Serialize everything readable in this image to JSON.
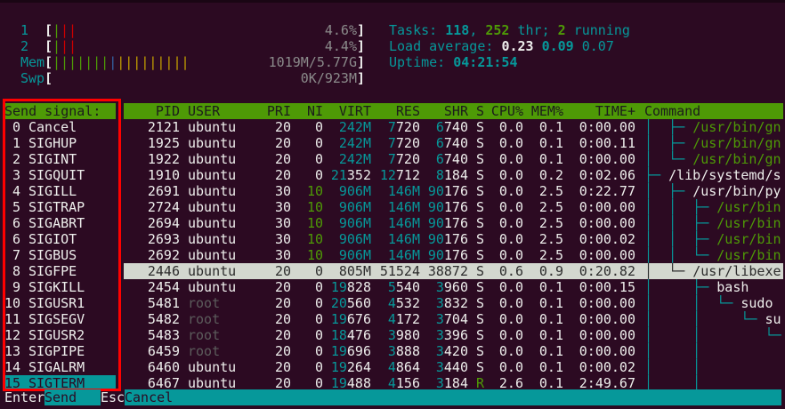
{
  "meters": {
    "cpu1": {
      "label": "1",
      "bars": [
        {
          "c": "green",
          "t": "|"
        },
        {
          "c": "red",
          "t": "||"
        }
      ],
      "value": "4.6%"
    },
    "cpu2": {
      "label": "2",
      "bars": [
        {
          "c": "green",
          "t": "|"
        },
        {
          "c": "red",
          "t": "||"
        }
      ],
      "value": "4.4%"
    },
    "mem": {
      "label": "Mem",
      "bars": [
        {
          "c": "green",
          "t": "|||||||"
        },
        {
          "c": "blue",
          "t": "|"
        },
        {
          "c": "yellow",
          "t": "|||||||||"
        }
      ],
      "value": "1019M/5.77G"
    },
    "swp": {
      "label": "Swp",
      "bars": [],
      "value": "0K/923M"
    }
  },
  "stats": {
    "tasks_label": "Tasks: ",
    "tasks": "118",
    "sep1": ", ",
    "threads": "252",
    "thr_label": " thr; ",
    "running": "2",
    "running_label": " running",
    "load_label": "Load average: ",
    "load1": "0.23",
    "load5": "0.09",
    "load15": "0.07",
    "uptime_label": "Uptime: ",
    "uptime": "04:21:54"
  },
  "signal_panel": {
    "title": "Send signal:",
    "signals": [
      {
        "num": "0",
        "name": "Cancel"
      },
      {
        "num": "1",
        "name": "SIGHUP"
      },
      {
        "num": "2",
        "name": "SIGINT"
      },
      {
        "num": "3",
        "name": "SIGQUIT"
      },
      {
        "num": "4",
        "name": "SIGILL"
      },
      {
        "num": "5",
        "name": "SIGTRAP"
      },
      {
        "num": "6",
        "name": "SIGABRT"
      },
      {
        "num": "6",
        "name": "SIGIOT"
      },
      {
        "num": "7",
        "name": "SIGBUS"
      },
      {
        "num": "8",
        "name": "SIGFPE"
      },
      {
        "num": "9",
        "name": "SIGKILL"
      },
      {
        "num": "10",
        "name": "SIGUSR1"
      },
      {
        "num": "11",
        "name": "SIGSEGV"
      },
      {
        "num": "12",
        "name": "SIGUSR2"
      },
      {
        "num": "13",
        "name": "SIGPIPE"
      },
      {
        "num": "14",
        "name": "SIGALRM"
      },
      {
        "num": "15",
        "name": "SIGTERM"
      }
    ],
    "selected_index": 16
  },
  "table": {
    "headers": {
      "pid": "PID",
      "user": "USER",
      "pri": "PRI",
      "ni": "NI",
      "virt": "VIRT",
      "res": "RES",
      "shr": "SHR",
      "s": "S",
      "cpu": "CPU%",
      "mem": "MEM%",
      "time": "TIME+",
      "cmd": "Command"
    },
    "selected_index": 9,
    "rows": [
      {
        "pid": "2121",
        "user": "ubuntu",
        "pri": "20",
        "ni": "0",
        "virt": "242M",
        "res": "7720",
        "shr": "6740",
        "s": "S",
        "cpu": "0.0",
        "mem": "0.1",
        "time": "0:00.00",
        "tree": "│  ├─ ",
        "cmd": "/usr/bin/gn",
        "cmd_color": "green"
      },
      {
        "pid": "1925",
        "user": "ubuntu",
        "pri": "20",
        "ni": "0",
        "virt": "242M",
        "res": "7720",
        "shr": "6740",
        "s": "S",
        "cpu": "0.0",
        "mem": "0.1",
        "time": "0:00.11",
        "tree": "│  ├─ ",
        "cmd": "/usr/bin/gn",
        "cmd_color": "green"
      },
      {
        "pid": "1922",
        "user": "ubuntu",
        "pri": "20",
        "ni": "0",
        "virt": "242M",
        "res": "7720",
        "shr": "6740",
        "s": "S",
        "cpu": "0.0",
        "mem": "0.1",
        "time": "0:00.00",
        "tree": "│  └─ ",
        "cmd": "/usr/bin/gn",
        "cmd_color": "green"
      },
      {
        "pid": "1910",
        "user": "ubuntu",
        "pri": "20",
        "ni": "0",
        "virt": "21352",
        "res": "12712",
        "shr": "8184",
        "s": "S",
        "cpu": "0.0",
        "mem": "0.2",
        "time": "0:02.06",
        "tree": "├─ ",
        "cmd": "/lib/systemd/s",
        "cmd_color": "white"
      },
      {
        "pid": "2691",
        "user": "ubuntu",
        "pri": "30",
        "ni": "10",
        "virt": "906M",
        "res": "146M",
        "shr": "90176",
        "s": "S",
        "cpu": "0.0",
        "mem": "2.5",
        "time": "0:22.77",
        "tree": "│  ├─ ",
        "cmd": "/usr/bin/py",
        "cmd_color": "white"
      },
      {
        "pid": "2724",
        "user": "ubuntu",
        "pri": "30",
        "ni": "10",
        "virt": "906M",
        "res": "146M",
        "shr": "90176",
        "s": "S",
        "cpu": "0.0",
        "mem": "2.5",
        "time": "0:00.00",
        "tree": "│  │  ├─ ",
        "cmd": "/usr/bin",
        "cmd_color": "green"
      },
      {
        "pid": "2694",
        "user": "ubuntu",
        "pri": "30",
        "ni": "10",
        "virt": "906M",
        "res": "146M",
        "shr": "90176",
        "s": "S",
        "cpu": "0.0",
        "mem": "2.5",
        "time": "0:00.00",
        "tree": "│  │  ├─ ",
        "cmd": "/usr/bin",
        "cmd_color": "green"
      },
      {
        "pid": "2693",
        "user": "ubuntu",
        "pri": "30",
        "ni": "10",
        "virt": "906M",
        "res": "146M",
        "shr": "90176",
        "s": "S",
        "cpu": "0.0",
        "mem": "2.5",
        "time": "0:00.02",
        "tree": "│  │  ├─ ",
        "cmd": "/usr/bin",
        "cmd_color": "green"
      },
      {
        "pid": "2692",
        "user": "ubuntu",
        "pri": "30",
        "ni": "10",
        "virt": "906M",
        "res": "146M",
        "shr": "90176",
        "s": "S",
        "cpu": "0.0",
        "mem": "2.5",
        "time": "0:00.00",
        "tree": "│  │  └─ ",
        "cmd": "/usr/bin",
        "cmd_color": "green"
      },
      {
        "pid": "2446",
        "user": "ubuntu",
        "pri": "20",
        "ni": "0",
        "virt": "805M",
        "res": "51524",
        "shr": "38872",
        "s": "S",
        "cpu": "0.6",
        "mem": "0.9",
        "time": "0:20.82",
        "tree": "│  └─ ",
        "cmd": "/usr/libexe",
        "cmd_color": "white"
      },
      {
        "pid": "2454",
        "user": "ubuntu",
        "pri": "20",
        "ni": "0",
        "virt": "19828",
        "res": "5540",
        "shr": "3960",
        "s": "S",
        "cpu": "0.0",
        "mem": "0.1",
        "time": "0:00.15",
        "tree": "│     ├─ ",
        "cmd": "bash",
        "cmd_color": "white"
      },
      {
        "pid": "5481",
        "user": "root",
        "pri": "20",
        "ni": "0",
        "virt": "20560",
        "res": "4532",
        "shr": "3832",
        "s": "S",
        "cpu": "0.0",
        "mem": "0.1",
        "time": "0:00.00",
        "tree": "│     │  └─ ",
        "cmd": "sudo",
        "cmd_color": "white"
      },
      {
        "pid": "5482",
        "user": "root",
        "pri": "20",
        "ni": "0",
        "virt": "19676",
        "res": "4172",
        "shr": "3704",
        "s": "S",
        "cpu": "0.0",
        "mem": "0.1",
        "time": "0:00.00",
        "tree": "│     │     └─ ",
        "cmd": "su",
        "cmd_color": "white"
      },
      {
        "pid": "5483",
        "user": "root",
        "pri": "20",
        "ni": "0",
        "virt": "18476",
        "res": "3980",
        "shr": "3396",
        "s": "S",
        "cpu": "0.0",
        "mem": "0.1",
        "time": "0:00.00",
        "tree": "│     │        └─",
        "cmd": "",
        "cmd_color": "white"
      },
      {
        "pid": "6459",
        "user": "root",
        "pri": "20",
        "ni": "0",
        "virt": "19696",
        "res": "3888",
        "shr": "3420",
        "s": "S",
        "cpu": "0.0",
        "mem": "0.1",
        "time": "0:00.00",
        "tree": "│     │",
        "cmd": "",
        "cmd_color": "white"
      },
      {
        "pid": "6460",
        "user": "ubuntu",
        "pri": "20",
        "ni": "0",
        "virt": "19264",
        "res": "4864",
        "shr": "3440",
        "s": "S",
        "cpu": "0.0",
        "mem": "0.1",
        "time": "0:00.02",
        "tree": "│     │",
        "cmd": "",
        "cmd_color": "white"
      },
      {
        "pid": "6467",
        "user": "ubuntu",
        "pri": "20",
        "ni": "0",
        "virt": "19488",
        "res": "4156",
        "shr": "3184",
        "s": "R",
        "cpu": "2.6",
        "mem": "0.1",
        "time": "2:49.67",
        "tree": "│     │",
        "cmd": "",
        "cmd_color": "white"
      }
    ]
  },
  "footer": {
    "enter_key": "Enter",
    "enter_label": "Send",
    "esc_key": "Esc",
    "esc_label": "Cancel"
  },
  "colors": {
    "background": "#2c0a22",
    "teal": "#06989a",
    "green": "#4e9a06",
    "highlight": "#d3d7cf",
    "annotation": "#ff0000"
  }
}
